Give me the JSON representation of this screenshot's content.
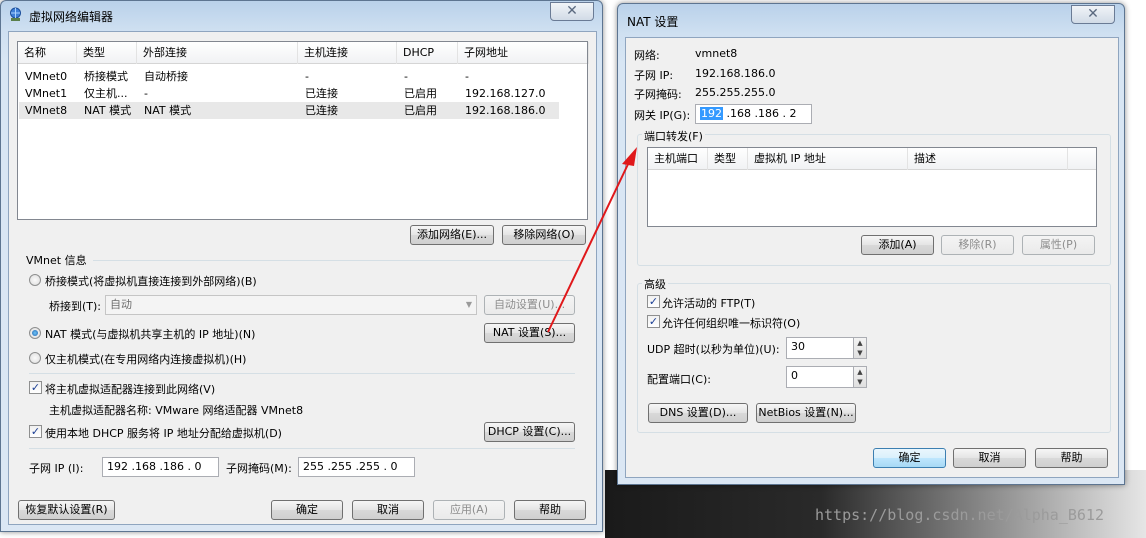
{
  "vne": {
    "title": "虚拟网络编辑器",
    "table": {
      "columns": [
        "名称",
        "类型",
        "外部连接",
        "主机连接",
        "DHCP",
        "子网地址"
      ],
      "rows": [
        [
          "VMnet0",
          "桥接模式",
          "自动桥接",
          "-",
          "-",
          "-"
        ],
        [
          "VMnet1",
          "仅主机...",
          "-",
          "已连接",
          "已启用",
          "192.168.127.0"
        ],
        [
          "VMnet8",
          "NAT 模式",
          "NAT 模式",
          "已连接",
          "已启用",
          "192.168.186.0"
        ]
      ]
    },
    "add_network": "添加网络(E)...",
    "remove_network": "移除网络(O)",
    "info_group": "VMnet 信息",
    "bridge_radio": "桥接模式(将虚拟机直接连接到外部网络)(B)",
    "bridge_to_label": "桥接到(T):",
    "bridge_to_value": "自动",
    "auto_settings": "自动设置(U)...",
    "nat_radio": "NAT 模式(与虚拟机共享主机的 IP 地址)(N)",
    "nat_settings": "NAT 设置(S)...",
    "hostonly_radio": "仅主机模式(在专用网络内连接虚拟机)(H)",
    "connect_adapter": "将主机虚拟适配器连接到此网络(V)",
    "adapter_name": "主机虚拟适配器名称: VMware 网络适配器 VMnet8",
    "use_dhcp": "使用本地 DHCP 服务将 IP 地址分配给虚拟机(D)",
    "dhcp_settings": "DHCP 设置(C)...",
    "subnet_ip_label": "子网 IP (I):",
    "subnet_ip": "192 .168 .186 . 0",
    "subnet_mask_label": "子网掩码(M):",
    "subnet_mask": "255 .255 .255 . 0",
    "restore_defaults": "恢复默认设置(R)",
    "ok": "确定",
    "cancel": "取消",
    "apply": "应用(A)",
    "help": "帮助"
  },
  "nat": {
    "title": "NAT 设置",
    "network_label": "网络:",
    "network_value": "vmnet8",
    "subnet_ip_label": "子网 IP:",
    "subnet_ip_value": "192.168.186.0",
    "subnet_mask_label": "子网掩码:",
    "subnet_mask_value": "255.255.255.0",
    "gateway_label": "网关 IP(G):",
    "gateway_selected": "192",
    "gateway_rest": " .168 .186 . 2",
    "port_forward_group": "端口转发(F)",
    "port_columns": [
      "主机端口",
      "类型",
      "虚拟机 IP 地址",
      "描述"
    ],
    "add": "添加(A)",
    "remove": "移除(R)",
    "properties": "属性(P)",
    "advanced_group": "高级",
    "allow_ftp": "允许活动的 FTP(T)",
    "allow_oui": "允许任何组织唯一标识符(O)",
    "udp_timeout_label": "UDP 超时(以秒为单位)(U):",
    "udp_timeout_value": "30",
    "config_port_label": "配置端口(C):",
    "config_port_value": "0",
    "dns_settings": "DNS 设置(D)...",
    "netbios_settings": "NetBios 设置(N)...",
    "ok": "确定",
    "cancel": "取消",
    "help": "帮助"
  },
  "watermark": "https://blog.csdn.net/Alpha_B612",
  "colors": {
    "arrow": "#e0181b",
    "selection": "#3399ff",
    "title_bar": "#b9d1ea"
  }
}
